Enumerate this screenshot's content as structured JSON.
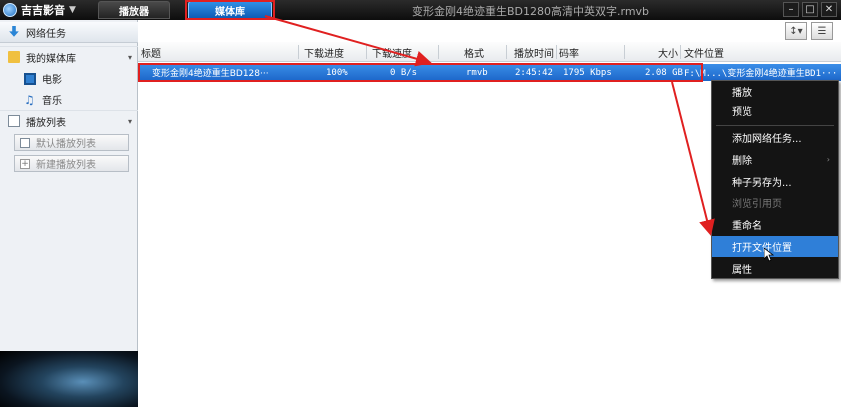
{
  "titlebar": {
    "brand": "吉吉影音",
    "tabs": [
      {
        "label": "播放器"
      },
      {
        "label": "媒体库"
      }
    ],
    "window_title": "变形金刚4绝迹重生BD1280高清中英双字.rmvb",
    "buttons": [
      "–",
      "□",
      "✕"
    ]
  },
  "toolbar": {
    "buttons": [
      "↕▾",
      "☰"
    ]
  },
  "sidebar": {
    "items": [
      {
        "label": "网络任务"
      },
      {
        "label": "我的媒体库"
      },
      {
        "label": "电影"
      },
      {
        "label": "音乐"
      },
      {
        "label": "播放列表"
      }
    ],
    "playlist_buttons": [
      {
        "label": "默认播放列表"
      },
      {
        "label": "新建播放列表"
      }
    ],
    "caret": "▾"
  },
  "table": {
    "columns": [
      "标题",
      "下载进度",
      "下载速度",
      "格式",
      "播放时间",
      "码率",
      "大小",
      "文件位置"
    ],
    "rows": [
      {
        "title": "变形金刚4绝迹重生BD128···",
        "progress": "100%",
        "speed": "0 B/s",
        "format": "rmvb",
        "duration": "2:45:42",
        "bitrate": "1795 Kbps",
        "size": "2.08 GB",
        "location": "F:\\M...\\变形金刚4绝迹重生BD1···"
      }
    ]
  },
  "context_menu": {
    "items": [
      {
        "label": "播放"
      },
      {
        "label": "预览"
      },
      {
        "label": "添加网络任务..."
      },
      {
        "label": "删除"
      },
      {
        "label": "种子另存为..."
      },
      {
        "label": "浏览引用页"
      },
      {
        "label": "重命名"
      },
      {
        "label": "打开文件位置"
      },
      {
        "label": "属性"
      }
    ],
    "submenu_arrow": "›"
  },
  "colors": {
    "accent": "#2f7fd8",
    "annotation": "#e02020",
    "menu_bg": "#141414"
  }
}
